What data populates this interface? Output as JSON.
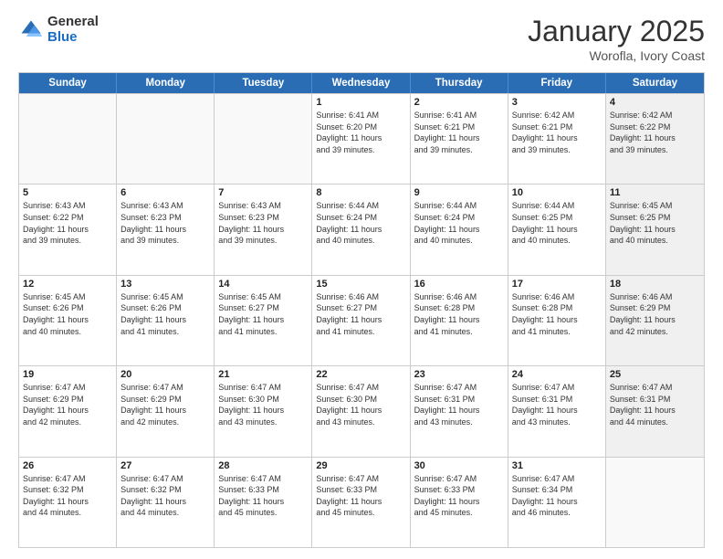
{
  "logo": {
    "general": "General",
    "blue": "Blue"
  },
  "title": "January 2025",
  "location": "Worofla, Ivory Coast",
  "header_days": [
    "Sunday",
    "Monday",
    "Tuesday",
    "Wednesday",
    "Thursday",
    "Friday",
    "Saturday"
  ],
  "weeks": [
    [
      {
        "day": "",
        "info": "",
        "empty": true
      },
      {
        "day": "",
        "info": "",
        "empty": true
      },
      {
        "day": "",
        "info": "",
        "empty": true
      },
      {
        "day": "1",
        "info": "Sunrise: 6:41 AM\nSunset: 6:20 PM\nDaylight: 11 hours\nand 39 minutes.",
        "empty": false
      },
      {
        "day": "2",
        "info": "Sunrise: 6:41 AM\nSunset: 6:21 PM\nDaylight: 11 hours\nand 39 minutes.",
        "empty": false
      },
      {
        "day": "3",
        "info": "Sunrise: 6:42 AM\nSunset: 6:21 PM\nDaylight: 11 hours\nand 39 minutes.",
        "empty": false
      },
      {
        "day": "4",
        "info": "Sunrise: 6:42 AM\nSunset: 6:22 PM\nDaylight: 11 hours\nand 39 minutes.",
        "empty": false,
        "shaded": true
      }
    ],
    [
      {
        "day": "5",
        "info": "Sunrise: 6:43 AM\nSunset: 6:22 PM\nDaylight: 11 hours\nand 39 minutes.",
        "empty": false
      },
      {
        "day": "6",
        "info": "Sunrise: 6:43 AM\nSunset: 6:23 PM\nDaylight: 11 hours\nand 39 minutes.",
        "empty": false
      },
      {
        "day": "7",
        "info": "Sunrise: 6:43 AM\nSunset: 6:23 PM\nDaylight: 11 hours\nand 39 minutes.",
        "empty": false
      },
      {
        "day": "8",
        "info": "Sunrise: 6:44 AM\nSunset: 6:24 PM\nDaylight: 11 hours\nand 40 minutes.",
        "empty": false
      },
      {
        "day": "9",
        "info": "Sunrise: 6:44 AM\nSunset: 6:24 PM\nDaylight: 11 hours\nand 40 minutes.",
        "empty": false
      },
      {
        "day": "10",
        "info": "Sunrise: 6:44 AM\nSunset: 6:25 PM\nDaylight: 11 hours\nand 40 minutes.",
        "empty": false
      },
      {
        "day": "11",
        "info": "Sunrise: 6:45 AM\nSunset: 6:25 PM\nDaylight: 11 hours\nand 40 minutes.",
        "empty": false,
        "shaded": true
      }
    ],
    [
      {
        "day": "12",
        "info": "Sunrise: 6:45 AM\nSunset: 6:26 PM\nDaylight: 11 hours\nand 40 minutes.",
        "empty": false
      },
      {
        "day": "13",
        "info": "Sunrise: 6:45 AM\nSunset: 6:26 PM\nDaylight: 11 hours\nand 41 minutes.",
        "empty": false
      },
      {
        "day": "14",
        "info": "Sunrise: 6:45 AM\nSunset: 6:27 PM\nDaylight: 11 hours\nand 41 minutes.",
        "empty": false
      },
      {
        "day": "15",
        "info": "Sunrise: 6:46 AM\nSunset: 6:27 PM\nDaylight: 11 hours\nand 41 minutes.",
        "empty": false
      },
      {
        "day": "16",
        "info": "Sunrise: 6:46 AM\nSunset: 6:28 PM\nDaylight: 11 hours\nand 41 minutes.",
        "empty": false
      },
      {
        "day": "17",
        "info": "Sunrise: 6:46 AM\nSunset: 6:28 PM\nDaylight: 11 hours\nand 41 minutes.",
        "empty": false
      },
      {
        "day": "18",
        "info": "Sunrise: 6:46 AM\nSunset: 6:29 PM\nDaylight: 11 hours\nand 42 minutes.",
        "empty": false,
        "shaded": true
      }
    ],
    [
      {
        "day": "19",
        "info": "Sunrise: 6:47 AM\nSunset: 6:29 PM\nDaylight: 11 hours\nand 42 minutes.",
        "empty": false
      },
      {
        "day": "20",
        "info": "Sunrise: 6:47 AM\nSunset: 6:29 PM\nDaylight: 11 hours\nand 42 minutes.",
        "empty": false
      },
      {
        "day": "21",
        "info": "Sunrise: 6:47 AM\nSunset: 6:30 PM\nDaylight: 11 hours\nand 43 minutes.",
        "empty": false
      },
      {
        "day": "22",
        "info": "Sunrise: 6:47 AM\nSunset: 6:30 PM\nDaylight: 11 hours\nand 43 minutes.",
        "empty": false
      },
      {
        "day": "23",
        "info": "Sunrise: 6:47 AM\nSunset: 6:31 PM\nDaylight: 11 hours\nand 43 minutes.",
        "empty": false
      },
      {
        "day": "24",
        "info": "Sunrise: 6:47 AM\nSunset: 6:31 PM\nDaylight: 11 hours\nand 43 minutes.",
        "empty": false
      },
      {
        "day": "25",
        "info": "Sunrise: 6:47 AM\nSunset: 6:31 PM\nDaylight: 11 hours\nand 44 minutes.",
        "empty": false,
        "shaded": true
      }
    ],
    [
      {
        "day": "26",
        "info": "Sunrise: 6:47 AM\nSunset: 6:32 PM\nDaylight: 11 hours\nand 44 minutes.",
        "empty": false
      },
      {
        "day": "27",
        "info": "Sunrise: 6:47 AM\nSunset: 6:32 PM\nDaylight: 11 hours\nand 44 minutes.",
        "empty": false
      },
      {
        "day": "28",
        "info": "Sunrise: 6:47 AM\nSunset: 6:33 PM\nDaylight: 11 hours\nand 45 minutes.",
        "empty": false
      },
      {
        "day": "29",
        "info": "Sunrise: 6:47 AM\nSunset: 6:33 PM\nDaylight: 11 hours\nand 45 minutes.",
        "empty": false
      },
      {
        "day": "30",
        "info": "Sunrise: 6:47 AM\nSunset: 6:33 PM\nDaylight: 11 hours\nand 45 minutes.",
        "empty": false
      },
      {
        "day": "31",
        "info": "Sunrise: 6:47 AM\nSunset: 6:34 PM\nDaylight: 11 hours\nand 46 minutes.",
        "empty": false
      },
      {
        "day": "",
        "info": "",
        "empty": true,
        "shaded": true
      }
    ]
  ]
}
